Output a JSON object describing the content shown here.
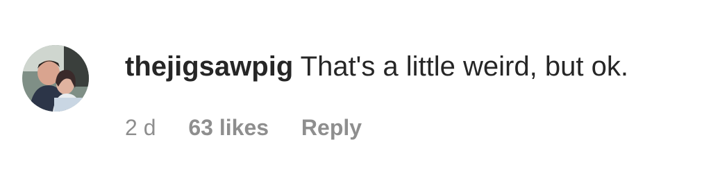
{
  "comment": {
    "username": "thejigsawpig",
    "text": "That's a little weird, but ok.",
    "timestamp": "2 d",
    "likes": "63 likes",
    "reply_label": "Reply"
  },
  "colors": {
    "primary_text": "#262626",
    "secondary_text": "#8e8e8e",
    "background": "#ffffff"
  },
  "icons": {
    "avatar": "user-avatar-photo"
  }
}
